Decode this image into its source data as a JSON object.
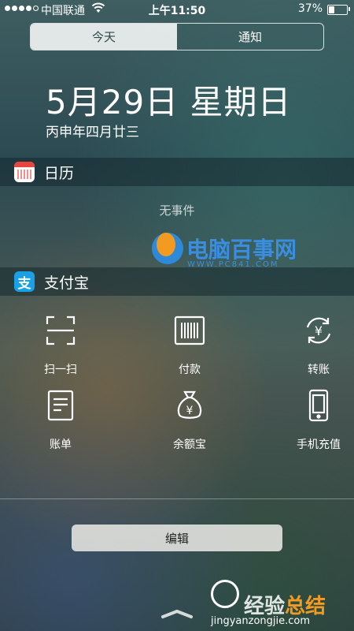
{
  "status_bar": {
    "signal_dots": 5,
    "signal_filled": 4,
    "carrier": "中国联通",
    "time": "上午11:50",
    "battery_percent": "37%",
    "battery_level": 0.37
  },
  "tabs": [
    {
      "label": "今天",
      "active": true
    },
    {
      "label": "通知",
      "active": false
    }
  ],
  "date": {
    "main": "5月29日 星期日",
    "lunar": "丙申年四月廿三"
  },
  "calendar_widget": {
    "title": "日历",
    "empty_text": "无事件"
  },
  "watermark": {
    "brand": "电脑百事网",
    "url": "WWW.PC841.COM"
  },
  "alipay_widget": {
    "title": "支付宝",
    "icon_glyph": "支",
    "actions": [
      {
        "label": "扫一扫",
        "icon": "scan-icon"
      },
      {
        "label": "付款",
        "icon": "barcode-icon"
      },
      {
        "label": "转账",
        "icon": "transfer-icon"
      },
      {
        "label": "账单",
        "icon": "bill-icon"
      },
      {
        "label": "余额宝",
        "icon": "money-bag-icon"
      },
      {
        "label": "手机充值",
        "icon": "phone-icon"
      }
    ]
  },
  "edit_button": "编辑",
  "bottom_watermark": {
    "brand_a": "经验",
    "brand_b": "总结",
    "url": "jingyanzongjie.com"
  },
  "colors": {
    "alipay_blue": "#1aa0e6",
    "calendar_red": "#e8453c",
    "watermark_blue": "#3a8ee0",
    "watermark_orange": "#f39b21"
  }
}
